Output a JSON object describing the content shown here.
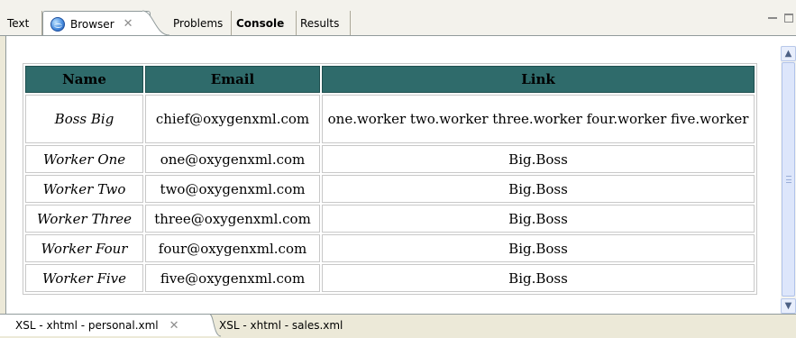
{
  "top_tabs": [
    {
      "label": "Text"
    },
    {
      "label": "Browser"
    },
    {
      "label": "Problems"
    },
    {
      "label": "Console"
    },
    {
      "label": "Results"
    }
  ],
  "table": {
    "headers": [
      "Name",
      "Email",
      "Link"
    ],
    "rows": [
      {
        "name": "Boss Big",
        "email": "chief@oxygenxml.com",
        "link": "one.worker two.worker three.worker four.worker five.worker"
      },
      {
        "name": "Worker One",
        "email": "one@oxygenxml.com",
        "link": "Big.Boss"
      },
      {
        "name": "Worker Two",
        "email": "two@oxygenxml.com",
        "link": "Big.Boss"
      },
      {
        "name": "Worker Three",
        "email": "three@oxygenxml.com",
        "link": "Big.Boss"
      },
      {
        "name": "Worker Four",
        "email": "four@oxygenxml.com",
        "link": "Big.Boss"
      },
      {
        "name": "Worker Five",
        "email": "five@oxygenxml.com",
        "link": "Big.Boss"
      }
    ]
  },
  "bottom_tabs": [
    {
      "label": "XSL - xhtml - personal.xml"
    },
    {
      "label": "XSL - xhtml - sales.xml"
    }
  ],
  "colors": {
    "header_bg": "#2f6b6b",
    "panel_bg": "#ece9d8"
  }
}
